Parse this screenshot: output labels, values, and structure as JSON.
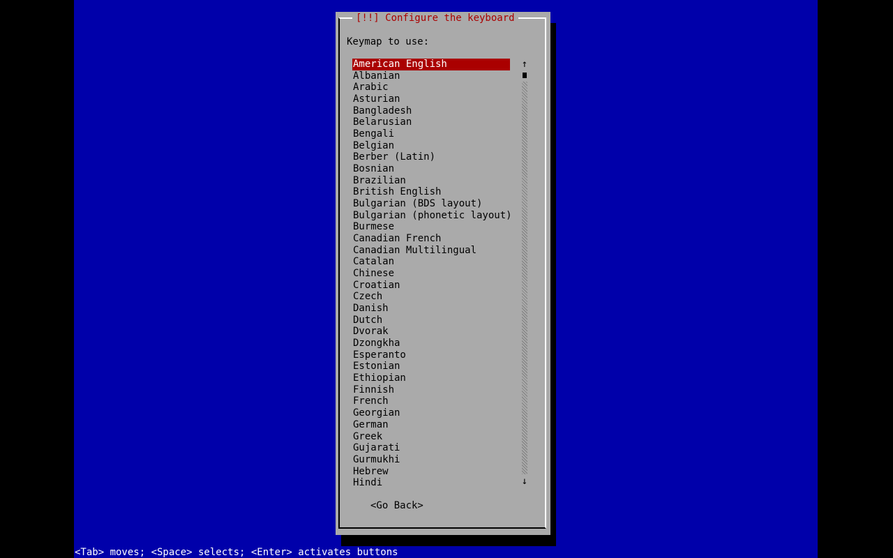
{
  "dialog": {
    "title": "[!!] Configure the keyboard",
    "prompt": "Keymap to use:",
    "keymaps": [
      "American English",
      "Albanian",
      "Arabic",
      "Asturian",
      "Bangladesh",
      "Belarusian",
      "Bengali",
      "Belgian",
      "Berber (Latin)",
      "Bosnian",
      "Brazilian",
      "British English",
      "Bulgarian (BDS layout)",
      "Bulgarian (phonetic layout)",
      "Burmese",
      "Canadian French",
      "Canadian Multilingual",
      "Catalan",
      "Chinese",
      "Croatian",
      "Czech",
      "Danish",
      "Dutch",
      "Dvorak",
      "Dzongkha",
      "Esperanto",
      "Estonian",
      "Ethiopian",
      "Finnish",
      "French",
      "Georgian",
      "German",
      "Greek",
      "Gujarati",
      "Gurmukhi",
      "Hebrew",
      "Hindi"
    ],
    "selected_keymap": "American English",
    "scroll_up_glyph": "↑",
    "scroll_down_glyph": "↓",
    "go_back_label": "<Go Back>"
  },
  "status_line": "<Tab> moves; <Space> selects; <Enter> activates buttons",
  "colors": {
    "console_background": "#0000AA",
    "dialog_background": "#AAAAAA",
    "title_text": "#AA0000",
    "selection_background": "#AA0000",
    "selection_text": "#FFFFFF",
    "status_text": "#FFFFFF"
  }
}
